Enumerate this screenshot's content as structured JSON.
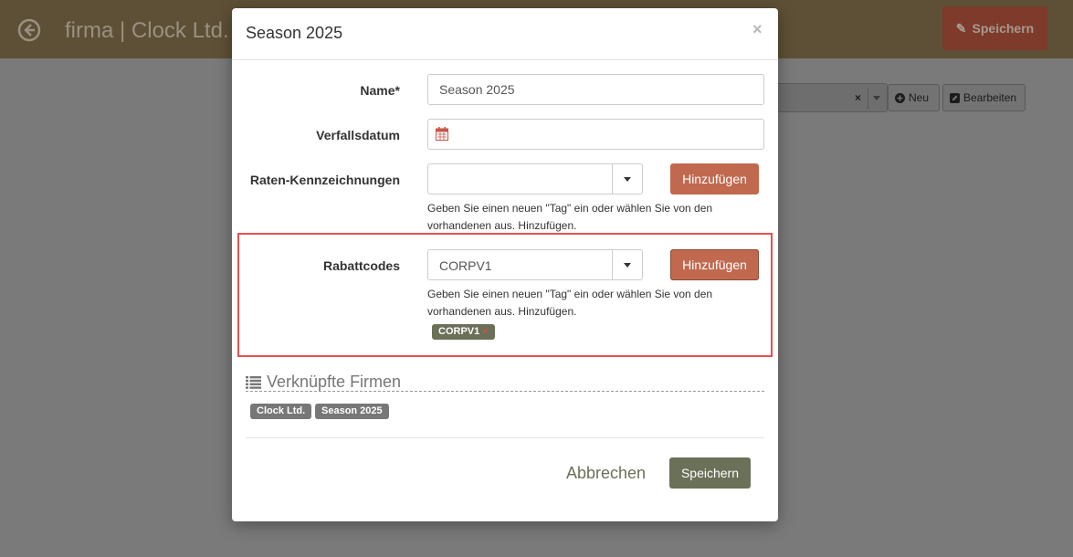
{
  "background": {
    "app_title": "firma | Clock Ltd.",
    "save_label": "Speichern",
    "new_label": "Neu",
    "edit_label": "Bearbeiten",
    "clear_symbol": "×"
  },
  "modal": {
    "title": "Season 2025",
    "close_symbol": "×",
    "fields": {
      "name_label": "Name*",
      "name_value": "Season 2025",
      "expiry_label": "Verfallsdatum",
      "expiry_value": "",
      "rate_tags_label": "Raten-Kennzeichnungen",
      "rate_tags_value": "",
      "rate_tags_add": "Hinzufügen",
      "rate_tags_help": "Geben Sie einen neuen \"Tag\" ein oder wählen Sie von den vorhandenen aus. Hinzufügen.",
      "discount_label": "Rabattcodes",
      "discount_value": "CORPV1",
      "discount_add": "Hinzufügen",
      "discount_help": "Geben Sie einen neuen \"Tag\" ein oder wählen Sie von den vorhandenen aus. Hinzufügen.",
      "discount_tags": [
        {
          "label": "CORPV1",
          "remove": "×"
        }
      ]
    },
    "linked": {
      "heading": "Verknüpfte Firmen",
      "tags": [
        "Clock Ltd.",
        "Season 2025"
      ]
    },
    "footer": {
      "cancel_label": "Abbrechen",
      "save_label": "Speichern"
    }
  },
  "colors": {
    "accent_orange": "#c1694f",
    "accent_olive": "#6b7058",
    "highlight_red": "#e8504f"
  }
}
